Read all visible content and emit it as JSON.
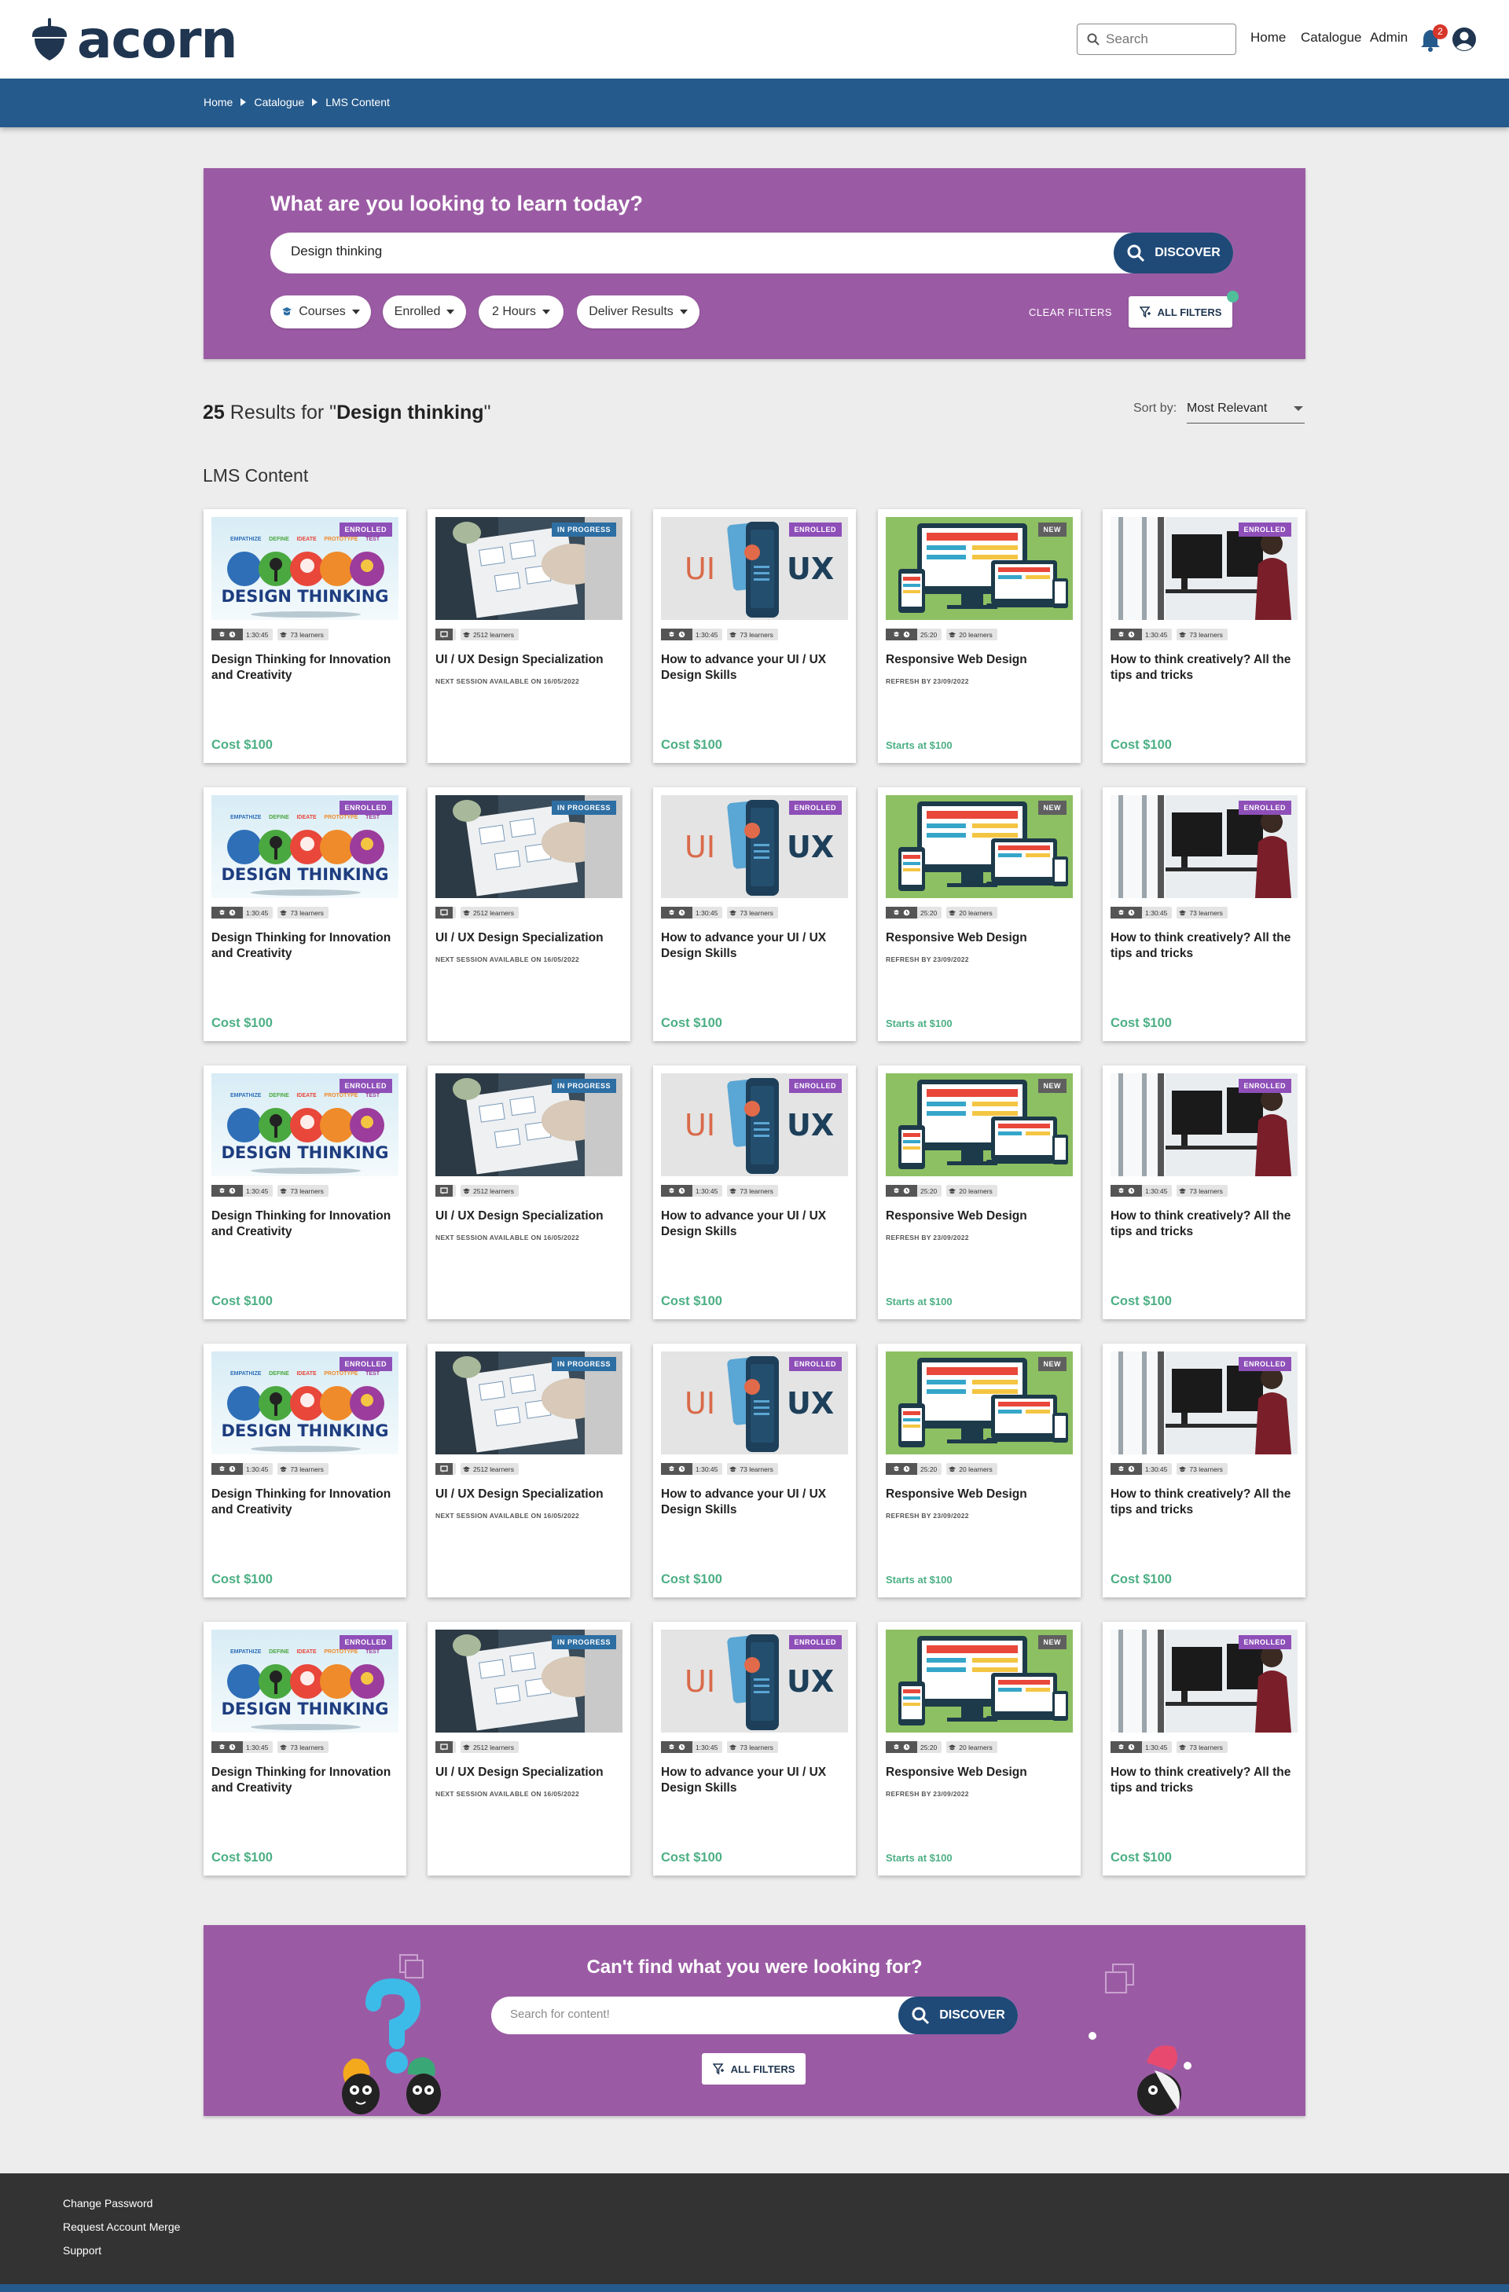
{
  "header": {
    "logo_text": "acorn",
    "search_placeholder": "Search",
    "nav": [
      "Home",
      "Catalogue",
      "Admin"
    ],
    "notification_count": "2"
  },
  "breadcrumb": [
    "Home",
    "Catalogue",
    "LMS Content"
  ],
  "hero": {
    "title": "What are you looking to learn today?",
    "search_value": "Design thinking",
    "discover_label": "DISCOVER",
    "filters": [
      "Courses",
      "Enrolled",
      "2 Hours",
      "Deliver Results"
    ],
    "clear_filters_label": "CLEAR FILTERS",
    "all_filters_label": "ALL FILTERS"
  },
  "results": {
    "count": "25",
    "label_pre": " Results for \"",
    "query": "Design thinking",
    "label_post": "\"",
    "sort_label": "Sort by:",
    "sort_value": "Most Relevant"
  },
  "section_title": "LMS Content",
  "card_templates": [
    {
      "image": "design-thinking",
      "badge": "ENROLLED",
      "badge_color": "#8e4fb8",
      "duration": "1:30:45",
      "learners": "73 learners",
      "title": "Design Thinking for Innovation and Creativity",
      "subtitle": "",
      "price": "Cost $100"
    },
    {
      "image": "ui-ux-desk",
      "badge": "IN PROGRESS",
      "badge_color": "#2d6ea3",
      "duration": "",
      "learners": "2512 learners",
      "title": "UI / UX Design Specialization",
      "subtitle": "NEXT SESSION AVAILABLE ON 16/05/2022",
      "price": ""
    },
    {
      "image": "ui-ux-phone",
      "badge": "ENROLLED",
      "badge_color": "#8e4fb8",
      "duration": "1:30:45",
      "learners": "73 learners",
      "title": "How to advance your UI / UX Design Skills",
      "subtitle": "",
      "price": "Cost $100"
    },
    {
      "image": "responsive",
      "badge": "NEW",
      "badge_color": "#5f5f5f",
      "duration": "25:20",
      "learners": "20 learners",
      "title": "Responsive Web Design",
      "subtitle": "REFRESH BY 23/09/2022",
      "price": "Starts at $100"
    },
    {
      "image": "creative-office",
      "badge": "ENROLLED",
      "badge_color": "#8e4fb8",
      "duration": "1:30:45",
      "learners": "73 learners",
      "title": "How to think creatively? All the tips and tricks",
      "subtitle": "",
      "price": "Cost $100"
    }
  ],
  "thumb_text": {
    "dt_steps": [
      "EMPATHIZE",
      "DEFINE",
      "IDEATE",
      "PROTOTYPE",
      "TEST"
    ],
    "dt_title": "DESIGN THINKING",
    "ui": "UI",
    "ux": "UX"
  },
  "row_count": 5,
  "banner": {
    "title": "Can't find what you were looking for?",
    "search_placeholder": "Search for content!",
    "discover_label": "DISCOVER",
    "all_filters_label": "ALL FILTERS"
  },
  "footer": {
    "links": [
      "Change Password",
      "Request Account Merge",
      "Support"
    ]
  },
  "colors": {
    "brand_dark": "#1f3550",
    "brand_blue": "#255a8c",
    "hero_purple": "#9b5ba4",
    "accent_green": "#4caf84"
  }
}
